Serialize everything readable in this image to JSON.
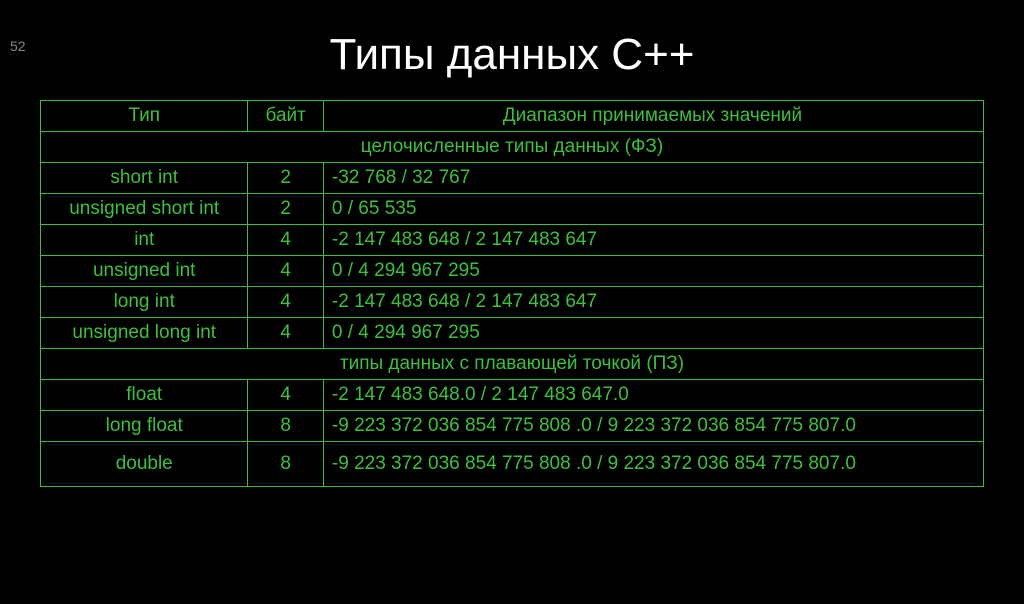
{
  "slide_number": "52",
  "title": "Типы данных С++",
  "headers": {
    "type": "Тип",
    "bytes": "байт",
    "range": "Диапазон принимаемых значений"
  },
  "section_integer": "целочисленные типы данных (ФЗ)",
  "section_float": "типы данных с плавающей точкой  (ПЗ)",
  "rows_integer": [
    {
      "type": "short int",
      "bytes": "2",
      "range": "-32 768    /    32 767"
    },
    {
      "type": "unsigned short int",
      "bytes": "2",
      "range": "0  /  65 535"
    },
    {
      "type": "int",
      "bytes": "4",
      "range": "-2 147 483 648   /   2 147 483 647"
    },
    {
      "type": "unsigned int",
      "bytes": "4",
      "range": "0     /     4 294 967 295"
    },
    {
      "type": "long int",
      "bytes": "4",
      "range": "-2 147 483 648    /    2 147 483 647"
    },
    {
      "type": "unsigned long int",
      "bytes": "4",
      "range": "0     /     4 294 967 295"
    }
  ],
  "rows_float": [
    {
      "type": "float",
      "bytes": "4",
      "range": "-2 147 483 648.0  / 2 147 483 647.0"
    },
    {
      "type": "long float",
      "bytes": "8",
      "range": "-9 223 372 036 854 775 808 .0   /    9 223 372 036 854 775 807.0"
    },
    {
      "type": "double",
      "bytes": "8",
      "range": "-9 223 372 036 854 775 808 .0   /    9 223 372 036 854 775 807.0"
    }
  ]
}
